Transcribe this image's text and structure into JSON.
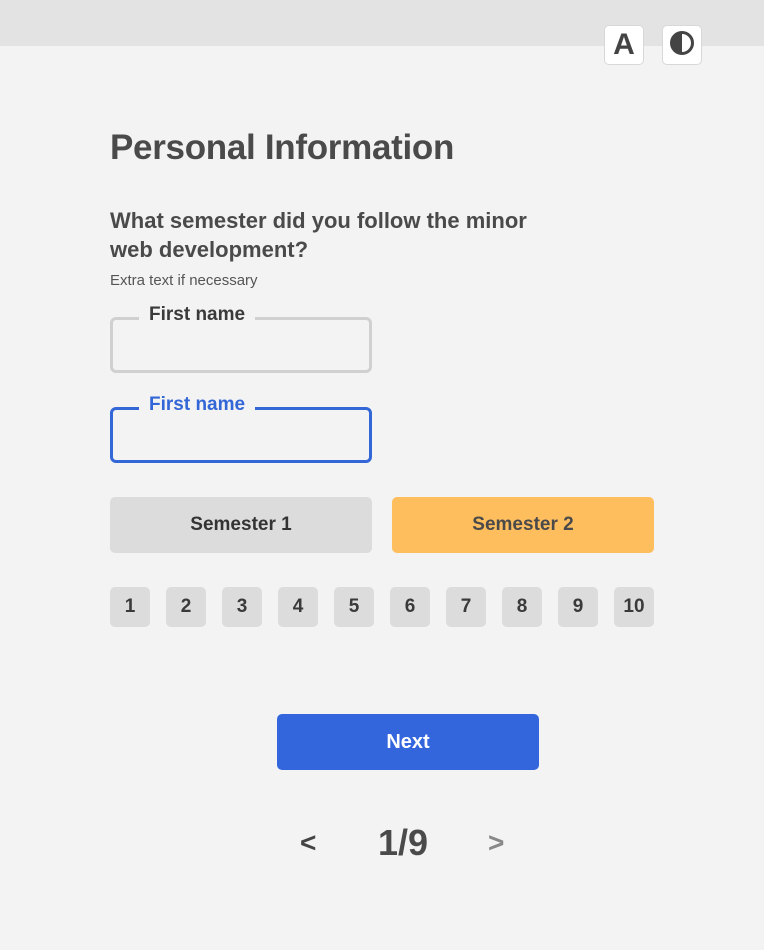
{
  "toolbar": {
    "font_size_label": "A",
    "contrast_icon": "contrast-icon"
  },
  "page": {
    "title": "Personal Information",
    "question": "What semester did you follow the minor web development?",
    "helper": "Extra text if necessary"
  },
  "fields": [
    {
      "label": "First name",
      "value": "",
      "state": "default"
    },
    {
      "label": "First name",
      "value": "",
      "state": "focused"
    }
  ],
  "choices": [
    {
      "label": "Semester 1",
      "selected": false
    },
    {
      "label": "Semester 2",
      "selected": true
    }
  ],
  "numbers": [
    "1",
    "2",
    "3",
    "4",
    "5",
    "6",
    "7",
    "8",
    "9",
    "10"
  ],
  "next_label": "Next",
  "pager": {
    "prev": "<",
    "count": "1/9",
    "next": ">"
  },
  "colors": {
    "primary": "#3366dd",
    "selected": "#ffbe5e",
    "neutral": "#dcdcdc",
    "focus": "#3366d6"
  }
}
